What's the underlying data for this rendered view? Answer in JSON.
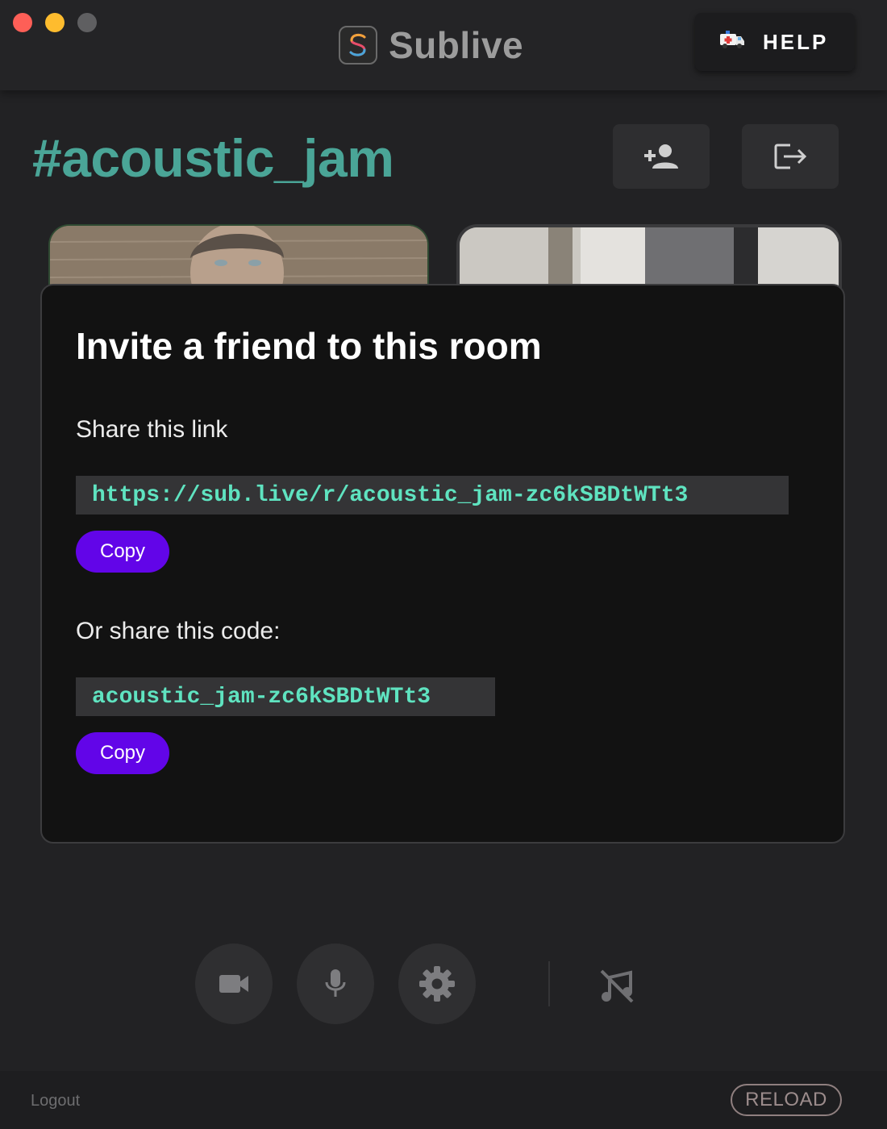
{
  "app": {
    "name": "Sublive"
  },
  "header": {
    "help_label": "HELP"
  },
  "room": {
    "title": "#acoustic_jam"
  },
  "invite_modal": {
    "title": "Invite a friend to this room",
    "link_label": "Share this link",
    "link": "https://sub.live/r/acoustic_jam-zc6kSBDtWTt3",
    "copy_label": "Copy",
    "code_label": "Or share this code:",
    "code": "acoustic_jam-zc6kSBDtWTt3",
    "copy_code_label": "Copy"
  },
  "controls": {
    "icons": [
      "video-camera-icon",
      "microphone-icon",
      "gear-icon",
      "music-off-icon"
    ]
  },
  "footer": {
    "logout_label": "Logout",
    "reload_label": "RELOAD"
  },
  "colors": {
    "accent": "#4aa597",
    "button_purple": "#6205e8",
    "code_text": "#5fe3c0",
    "background": "#222224"
  }
}
